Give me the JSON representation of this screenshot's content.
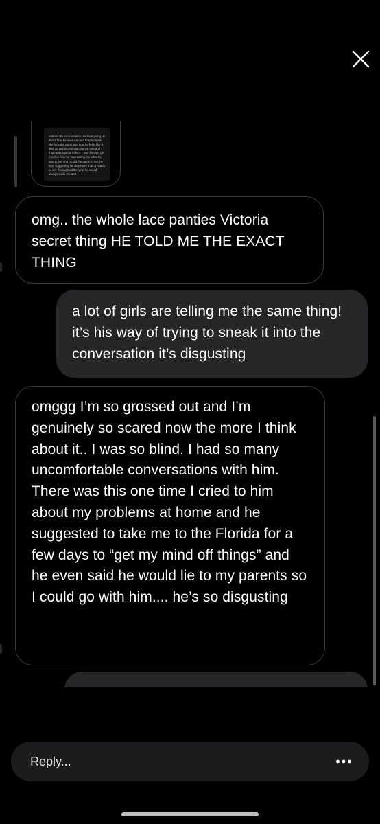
{
  "header": {
    "close_icon": "close-icon"
  },
  "media_preview": {
    "text": "redirect the conversation. He kept going on about how he sees me and how he feels like he's the same and how he feels like it was something special that we met and that I was special to him. I saw another girl mention how he kept asking her what he was to her and he did the same to me, he kept suggesting he was more than a coach to me. Throughout the year he would always invite me and"
  },
  "messages": [
    {
      "direction": "incoming",
      "text": "omg.. the whole lace panties Victoria secret thing HE TOLD ME THE EXACT THING"
    },
    {
      "direction": "outgoing",
      "text": "a lot of girls are telling me the same thing! it’s his way of trying to sneak it into the conversation it’s disgusting"
    },
    {
      "direction": "incoming",
      "text": "omggg I’m so grossed out and I’m genuinely so scared now the more I think about it.. I was so blind. I had so many uncomfortable conversations with him. There was this one time I cried to him about my problems at home and he suggested to take me to the Florida for a few days to “get my mind off things” and he even said he would lie to my parents so I could go with him.... he’s so disgusting"
    },
    {
      "direction": "outgoing",
      "text": ""
    }
  ],
  "reply": {
    "placeholder": "Reply...",
    "more_icon": "more-horizontal-icon"
  },
  "colors": {
    "background": "#000000",
    "incoming_border": "#3a3a3c",
    "outgoing_bubble": "#262628",
    "reply_bar": "#1c1c1e",
    "text": "#ffffff"
  }
}
